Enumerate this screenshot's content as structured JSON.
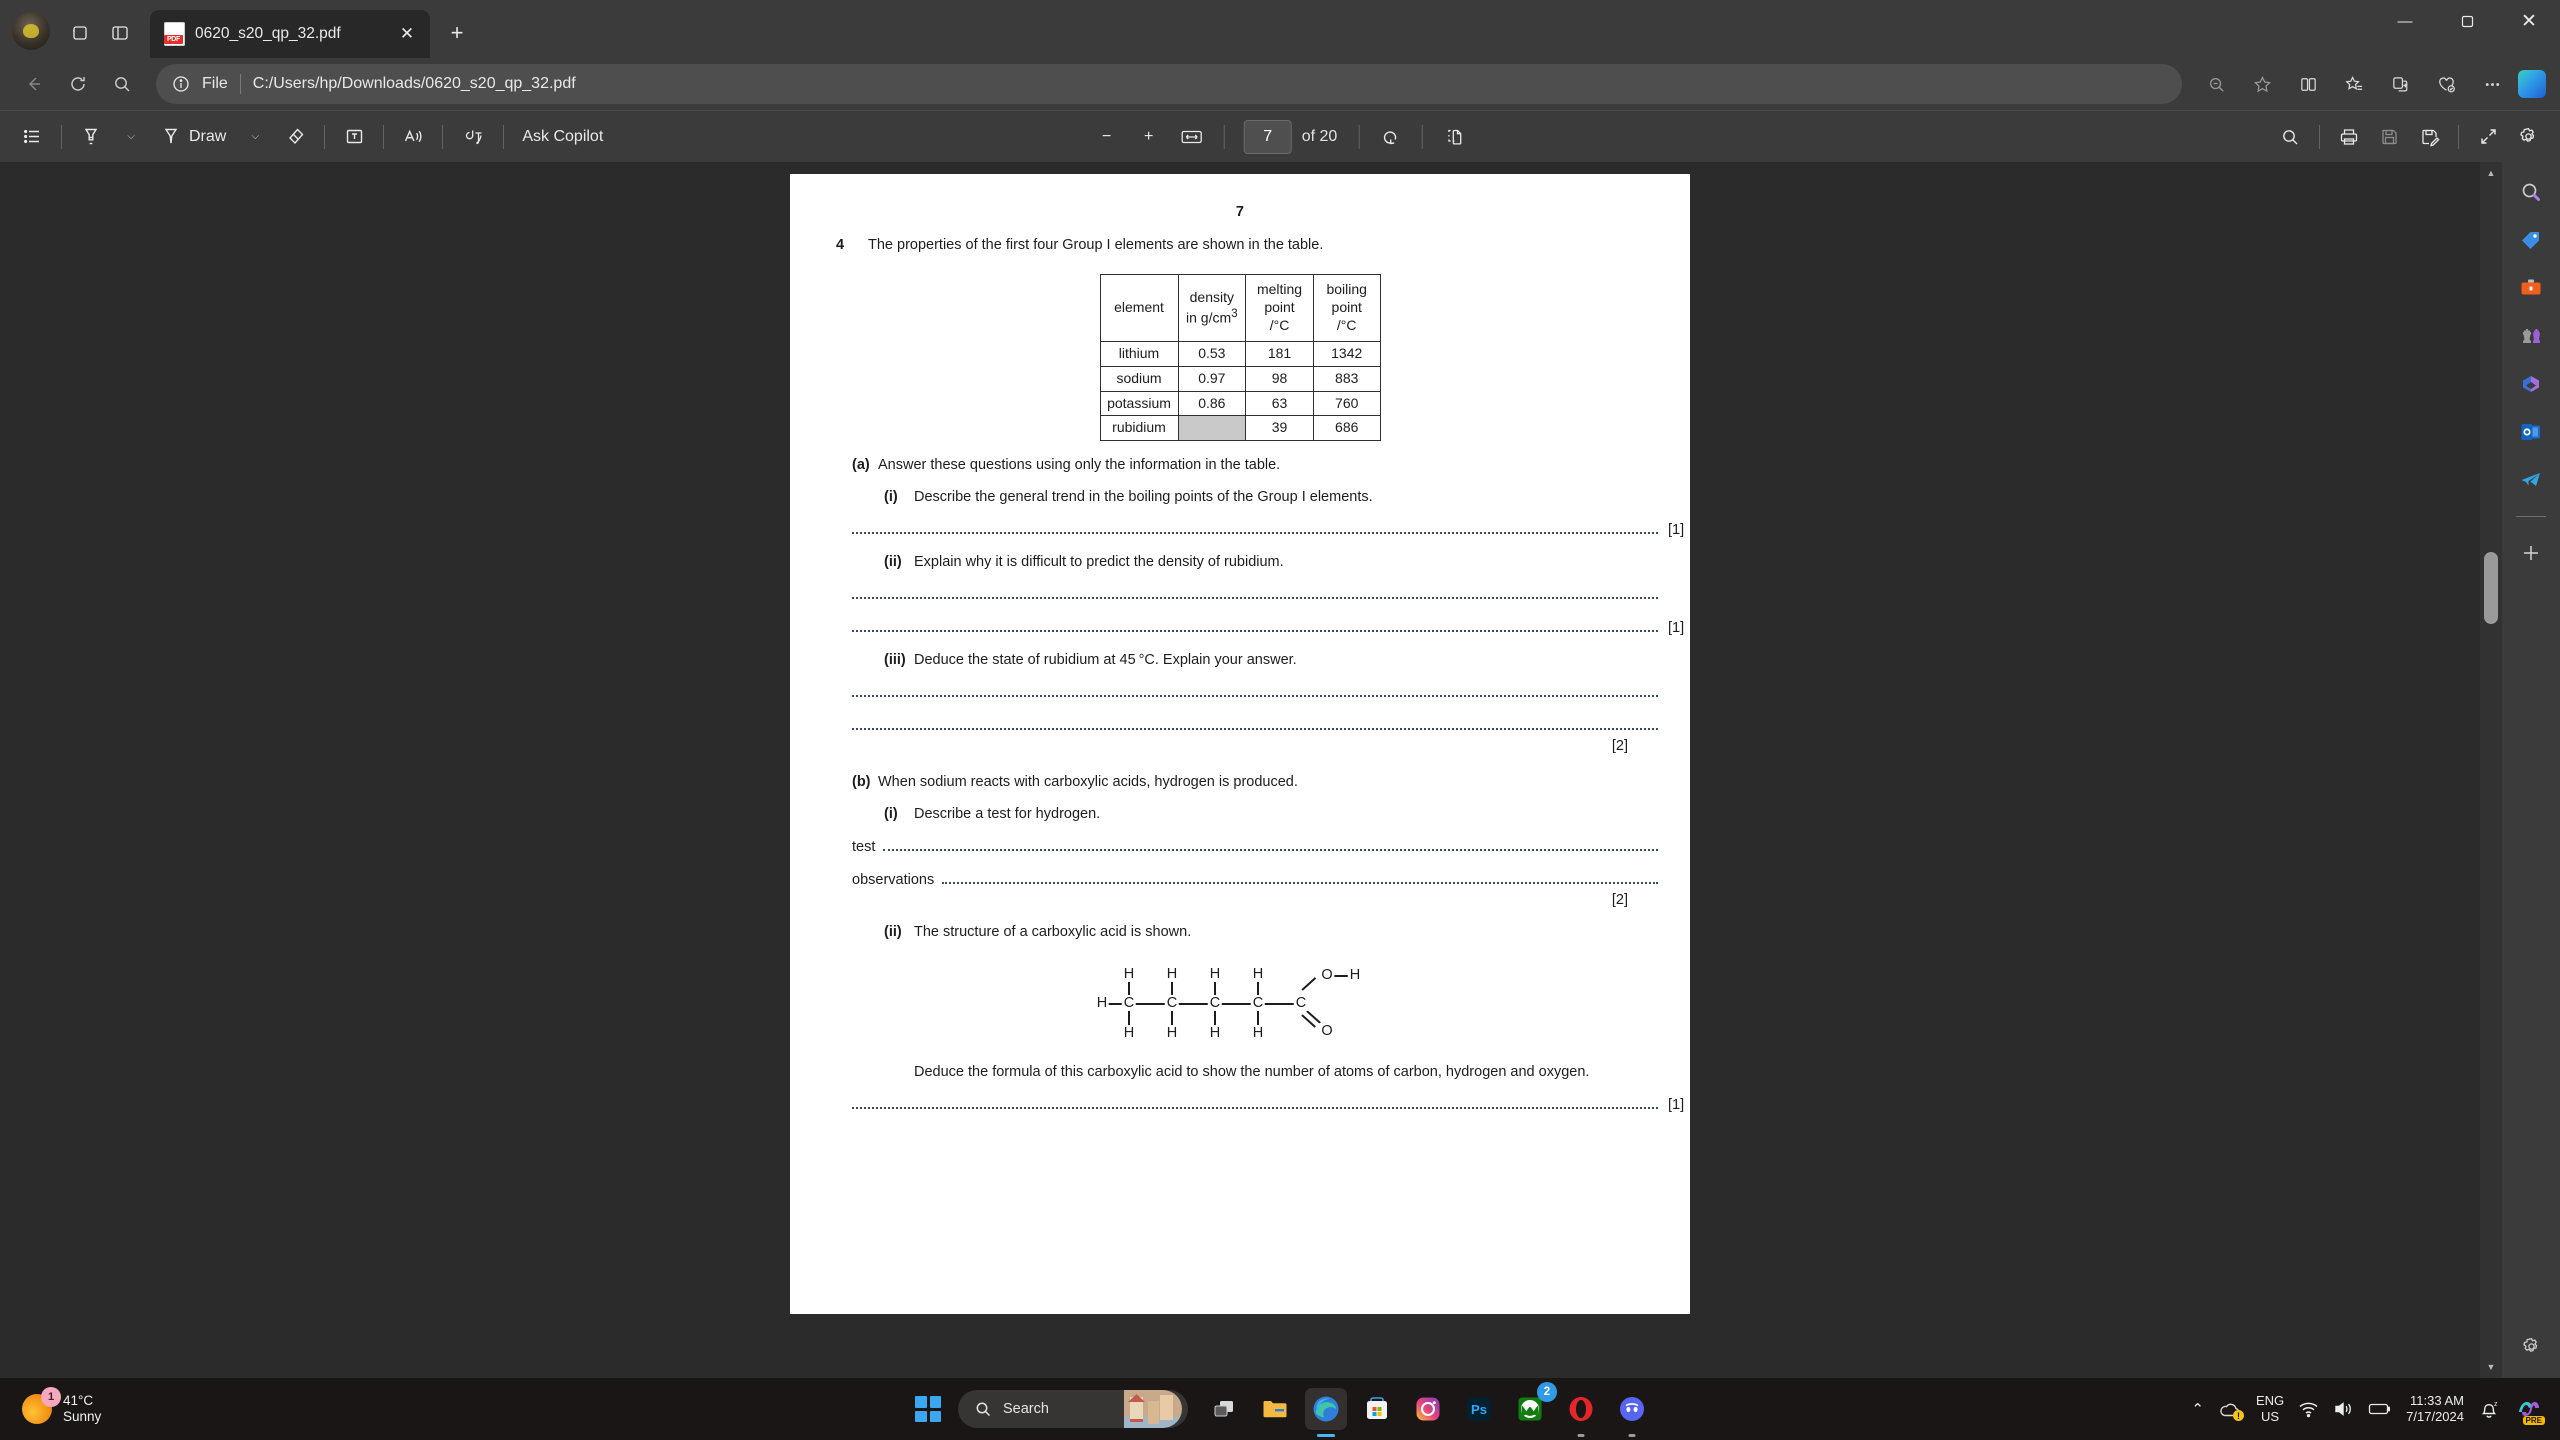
{
  "window": {
    "tab_title": "0620_s20_qp_32.pdf",
    "tab_close": "✕",
    "new_tab": "+",
    "minimize": "—",
    "maximize": "❐",
    "close": "✕"
  },
  "address": {
    "file_label": "File",
    "url": "C:/Users/hp/Downloads/0620_s20_qp_32.pdf"
  },
  "pdf_toolbar": {
    "draw_label": "Draw",
    "ask_copilot": "Ask Copilot",
    "zoom_out": "−",
    "zoom_in": "+",
    "page_value": "7",
    "page_of": "of 20",
    "chevron": "⌵"
  },
  "document": {
    "page_number": "7",
    "question_number": "4",
    "question_stem": "The properties of the first four Group I elements are shown in the table.",
    "table": {
      "headers": [
        "element",
        "density\nin g/cm3",
        "melting point\n/°C",
        "boiling point\n/°C"
      ],
      "header_element": "element",
      "header_density_l1": "density",
      "header_density_l2": "in g/cm",
      "header_density_sup": "3",
      "header_melting_l1": "melting point",
      "header_melting_l2": "/°C",
      "header_boiling_l1": "boiling point",
      "header_boiling_l2": "/°C",
      "rows": [
        {
          "element": "lithium",
          "density": "0.53",
          "melting": "181",
          "boiling": "1342",
          "density_shaded": false
        },
        {
          "element": "sodium",
          "density": "0.97",
          "melting": "98",
          "boiling": "883",
          "density_shaded": false
        },
        {
          "element": "potassium",
          "density": "0.86",
          "melting": "63",
          "boiling": "760",
          "density_shaded": false
        },
        {
          "element": "rubidium",
          "density": "",
          "melting": "39",
          "boiling": "686",
          "density_shaded": true
        }
      ]
    },
    "part_a": {
      "label": "(a)",
      "text": "Answer these questions using only the information in the table.",
      "i": {
        "label": "(i)",
        "text": "Describe the general trend in the boiling points of the Group I elements.",
        "marks": "[1]"
      },
      "ii": {
        "label": "(ii)",
        "text": "Explain why it is difficult to predict the density of rubidium.",
        "marks": "[1]"
      },
      "iii": {
        "label": "(iii)",
        "text": "Deduce the state of rubidium at 45 °C. Explain your answer.",
        "marks": "[2]"
      }
    },
    "part_b": {
      "label": "(b)",
      "text": "When sodium reacts with carboxylic acids, hydrogen is produced.",
      "i": {
        "label": "(i)",
        "text": "Describe a test for hydrogen.",
        "test_label": "test",
        "observations_label": "observations",
        "marks": "[2]"
      },
      "ii": {
        "label": "(ii)",
        "text": "The structure of a carboxylic acid is shown.",
        "deduce_text": "Deduce the formula of this carboxylic acid to show the number of atoms of carbon, hydrogen and oxygen.",
        "marks": "[1]",
        "molecule": {
          "left_h": "H",
          "carbons": [
            "C",
            "C",
            "C",
            "C",
            "C"
          ],
          "top_hydrogens": [
            "H",
            "H",
            "H",
            "H"
          ],
          "bottom_hydrogens": [
            "H",
            "H",
            "H",
            "H"
          ],
          "hydroxyl_o": "O",
          "hydroxyl_h": "H",
          "carbonyl_o": "O"
        }
      }
    }
  },
  "taskbar": {
    "weather_temp": "41°C",
    "weather_cond": "Sunny",
    "weather_badge": "1",
    "search_placeholder": "Search",
    "xbox_badge": "2",
    "language": "ENG",
    "region": "US",
    "time": "11:33 AM",
    "date": "7/17/2024",
    "copilot_tag": "PRE",
    "tray_chevron": "⌃"
  },
  "colors": {
    "accent": "#4cb3f5",
    "titlebar": "#3b3b3b",
    "tab_active": "#282828",
    "page_bg": "#ffffff",
    "shaded_cell": "#c9c9c9",
    "taskbar": "#1b1616"
  }
}
